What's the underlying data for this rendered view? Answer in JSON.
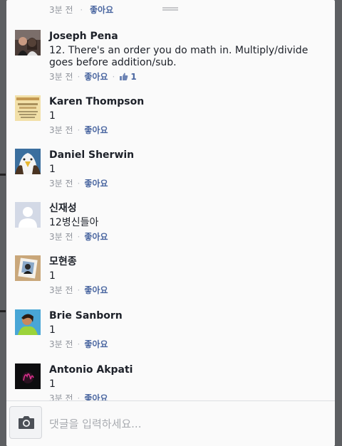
{
  "top_partial": {
    "time": "3분 전",
    "like_label": "좋아요"
  },
  "comments": [
    {
      "name": "Joseph Pena",
      "text": "12. There's an order you do math in. Multiply/divide goes before addition/sub.",
      "time": "3분 전",
      "like_label": "좋아요",
      "likes": "1"
    },
    {
      "name": "Karen Thompson",
      "text": "1",
      "time": "3분 전",
      "like_label": "좋아요"
    },
    {
      "name": "Daniel Sherwin",
      "text": "1",
      "time": "3분 전",
      "like_label": "좋아요"
    },
    {
      "name": "신재성",
      "text": "12병신들아",
      "time": "3분 전",
      "like_label": "좋아요"
    },
    {
      "name": "모현종",
      "text": "1",
      "time": "3분 전",
      "like_label": "좋아요"
    },
    {
      "name": "Brie Sanborn",
      "text": "1",
      "time": "3분 전",
      "like_label": "좋아요"
    },
    {
      "name": "Antonio Akpati",
      "text": "1",
      "time": "3분 전",
      "like_label": "좋아요"
    }
  ],
  "composer": {
    "placeholder": "댓글을 입력하세요...",
    "camera_icon": "camera-icon"
  },
  "colors": {
    "link": "#4b67a1",
    "meta": "#90949c",
    "text": "#1d2129"
  }
}
